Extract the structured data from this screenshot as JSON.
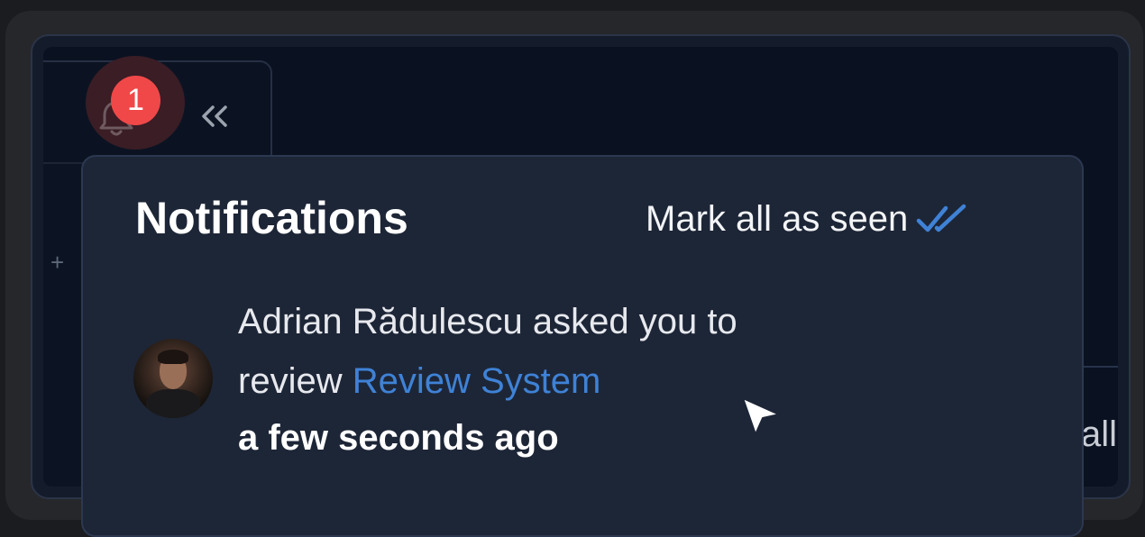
{
  "header": {
    "notification_count": "1",
    "collapse_glyph": "«"
  },
  "sidebar": {
    "add_glyph": "+"
  },
  "background_fragment": "all",
  "notifications": {
    "title": "Notifications",
    "mark_all_label": "Mark all as seen",
    "items": [
      {
        "actor": "Adrian Rădulescu",
        "message_mid": " asked you to review ",
        "link_text": "Review System",
        "time": "a few seconds ago",
        "avatar_icon": "user-avatar"
      }
    ]
  },
  "icons": {
    "bell": "bell-icon",
    "collapse": "double-chevron-left-icon",
    "mark_all": "double-check-icon",
    "cursor": "mouse-cursor-icon"
  },
  "colors": {
    "badge": "#f04848",
    "link": "#3f82d6",
    "panel_bg": "#1d2637",
    "page_bg": "#0a1120"
  }
}
